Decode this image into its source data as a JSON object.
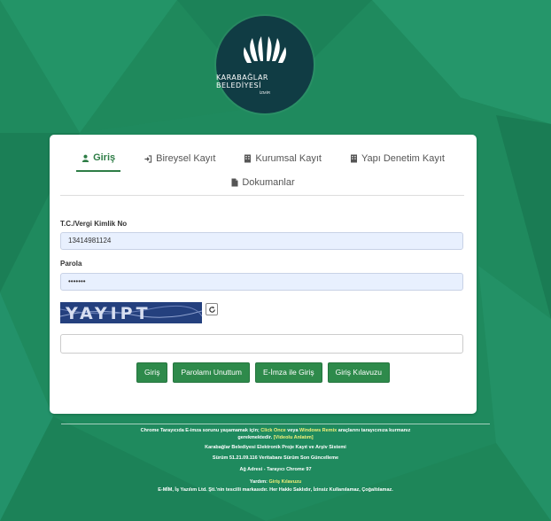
{
  "logo": {
    "name": "KARABAĞLAR BELEDİYESİ",
    "city": "İZMİR"
  },
  "tabs": [
    {
      "label": "Giriş",
      "icon": "user-icon",
      "active": true
    },
    {
      "label": "Bireysel Kayıt",
      "icon": "sign-in-icon",
      "active": false
    },
    {
      "label": "Kurumsal Kayıt",
      "icon": "building-icon",
      "active": false
    },
    {
      "label": "Yapı Denetim Kayıt",
      "icon": "building-icon",
      "active": false
    },
    {
      "label": "Dokumanlar",
      "icon": "document-icon",
      "active": false
    }
  ],
  "form": {
    "id_label": "T.C./Vergi Kimlik No",
    "id_value": "13414981124",
    "password_label": "Parola",
    "password_value": "•••••••",
    "captcha_text": "YAYIPT",
    "captcha_input_value": ""
  },
  "buttons": {
    "login": "Giriş",
    "forgot": "Parolamı Unuttum",
    "eimza": "E-İmza ile Giriş",
    "guide": "Giriş Kılavuzu"
  },
  "footer": {
    "l1a": "Chrome Tarayıcıda E-imza sorunu yaşamamak için;",
    "l1b": "Click Once",
    "l1c": "veya",
    "l1d": "Windows Remix",
    "l1e": "araçlarını tarayıcınıza kurmanız",
    "l2a": "gerekmektedir.",
    "l2b": "[Videolu Anlatım]",
    "l3": "Karabağlar Belediyesi Elektronik Proje Kayıt ve Arşiv Sistemi",
    "l4": "Sürüm 51.21.09.116 Veritabanı Sürüm  Son Güncelleme",
    "l5": "Ağ Adresi - Tarayıcı Chrome 97",
    "l6a": "Yardım:",
    "l6b": "Giriş Kılavuzu",
    "l7": "E-MİM, İş Yazılım Ltd. Şti.'nin tescilli markasıdır. Her Hakkı Saklıdır, İzinsiz Kullanılamaz, Çoğaltılamaz."
  },
  "colors": {
    "accent": "#2e8a4b",
    "background": "#1f8a5e",
    "logo": "#103c44"
  }
}
